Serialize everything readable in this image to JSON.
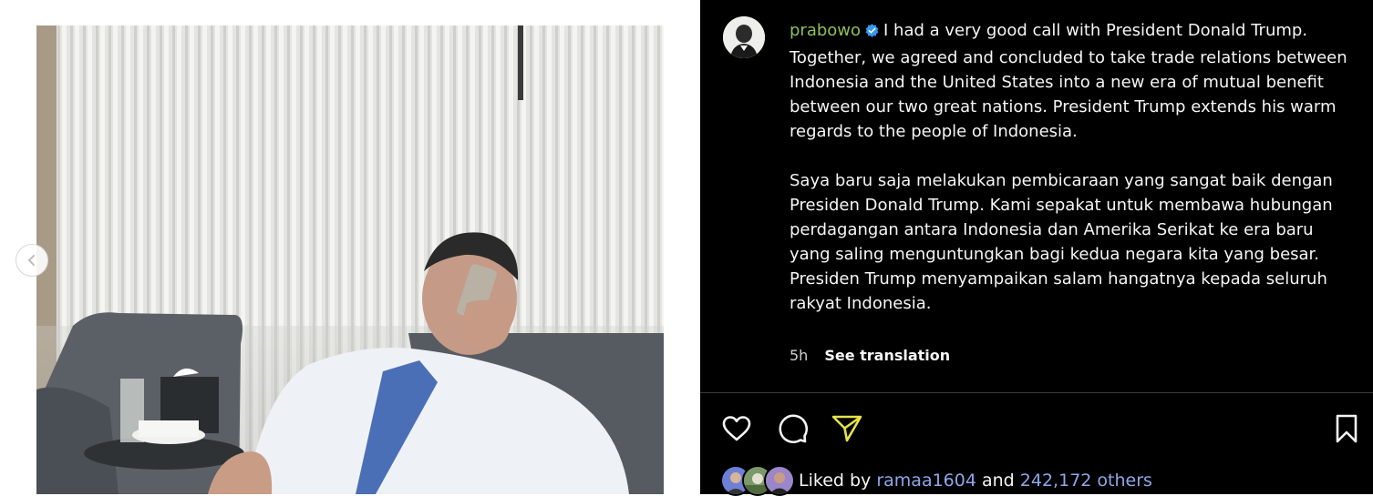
{
  "post": {
    "username": "prabowo",
    "caption_en": "I had a very good call with President Donald Trump. Together, we agreed and concluded to take trade relations between Indonesia and the United States into a new era of mutual benefit between our two great nations. President Trump extends his warm regards to the people of Indonesia.",
    "caption_id_1": "Saya baru saja melakukan pembicaraan yang sangat baik dengan Presiden Donald Trump. Kami sepakat untuk membawa hubungan perdagangan antara Indonesia dan Amerika Serikat ke era baru yang saling menguntungkan bagi kedua negara kita yang besar.",
    "caption_id_2": "Presiden Trump menyampaikan salam hangatnya kepada seluruh rakyat Indonesia.",
    "time_ago": "5h",
    "see_translation": "See translation"
  },
  "likes": {
    "prefix": "Liked by",
    "first_user": "ramaa1604",
    "conjunction": "and",
    "others": "242,172 others"
  },
  "icons": {
    "verified": "verified-badge-icon",
    "like": "heart-icon",
    "comment": "comment-icon",
    "share": "send-icon",
    "save": "bookmark-icon",
    "prev": "chevron-left-icon"
  },
  "colors": {
    "username": "#8fbf5a",
    "link": "#8fa6e8",
    "share_icon": "#e6e24a",
    "verified": "#3897f0"
  }
}
